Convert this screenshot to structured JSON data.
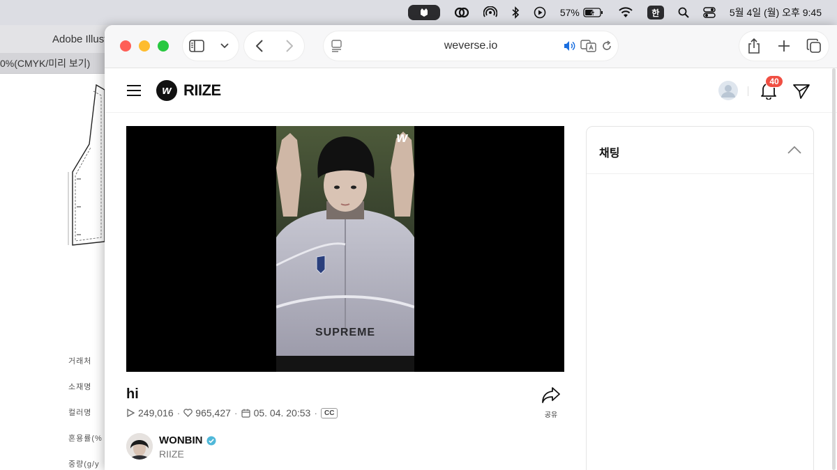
{
  "menubar": {
    "battery": "57%",
    "input_method": "한",
    "clock": "5월 4일 (월) 오후 9:45"
  },
  "illustrator": {
    "app_title": "Adobe Illustrator",
    "doc_tab": "0%(CMYK/미리 보기)",
    "labels": [
      "거래처",
      "소재명",
      "컬러명",
      "혼용률(%",
      "중량(g/y"
    ]
  },
  "browser": {
    "url": "weverse.io"
  },
  "weverse": {
    "brand": "RIIZE",
    "notification_count": "40",
    "post": {
      "title": "hi",
      "views": "249,016",
      "likes": "965,427",
      "date": "05. 04. 20:53",
      "cc": "CC",
      "share_label": "공유"
    },
    "artist": {
      "name": "WONBIN",
      "group": "RIIZE"
    },
    "chat": {
      "title": "채팅"
    }
  }
}
